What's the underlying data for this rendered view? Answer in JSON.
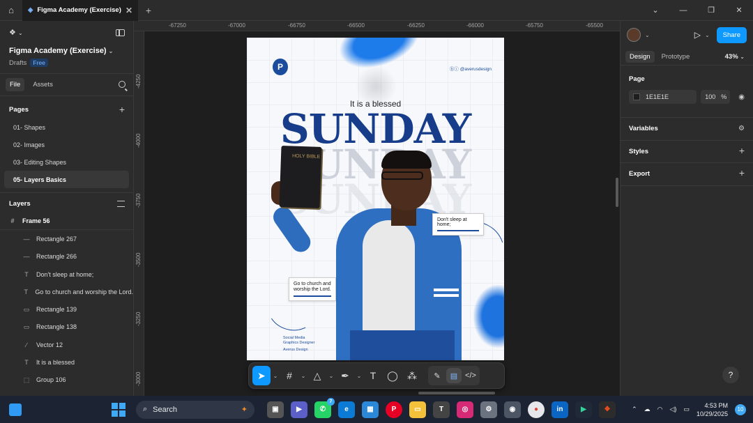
{
  "titlebar": {
    "tab_title": "Figma Academy (Exercise)"
  },
  "left_panel": {
    "file_name": "Figma Academy (Exercise)",
    "location": "Drafts",
    "plan_badge": "Free",
    "tabs": [
      "File",
      "Assets"
    ],
    "pages_header": "Pages",
    "pages": [
      "01- Shapes",
      "02- Images",
      "03- Editing Shapes",
      "05- Layers Basics"
    ],
    "layers_header": "Layers",
    "frame_name": "Frame 56",
    "layers": [
      {
        "icon": "line-icon",
        "glyph": "—",
        "name": "Rectangle 267"
      },
      {
        "icon": "line-icon",
        "glyph": "—",
        "name": "Rectangle 266"
      },
      {
        "icon": "text-icon",
        "glyph": "T",
        "name": "Don't sleep at home;"
      },
      {
        "icon": "text-icon",
        "glyph": "T",
        "name": "Go to church and worship the Lord."
      },
      {
        "icon": "rectangle-icon",
        "glyph": "▭",
        "name": "Rectangle 139"
      },
      {
        "icon": "rectangle-icon",
        "glyph": "▭",
        "name": "Rectangle 138"
      },
      {
        "icon": "vector-icon",
        "glyph": "∕",
        "name": "Vector 12"
      },
      {
        "icon": "text-icon",
        "glyph": "T",
        "name": "It is a blessed"
      },
      {
        "icon": "group-icon",
        "glyph": "⬚",
        "name": "Group 106"
      }
    ]
  },
  "rulers": {
    "top": [
      "-67250",
      "-67000",
      "-66750",
      "-66500",
      "-66250",
      "-66000",
      "-65750",
      "-65500"
    ],
    "left": [
      "-4250",
      "-4000",
      "-3750",
      "-3500",
      "-3250",
      "-3000"
    ]
  },
  "poster": {
    "social": "ⓑⓘ @averusdesign",
    "blessed": "It is a blessed",
    "sunday": "SUNDAY",
    "bible_text": "HOLY BIBLE",
    "callout_home": "Don't sleep at home;",
    "callout_church": "Go to church and worship the Lord.",
    "credit_role": "Social Media Graphics Designer",
    "credit_name": "Averus Design",
    "logo_letter": "P"
  },
  "toolbar": {
    "tools": [
      "move-tool",
      "frame-tool",
      "shape-tool",
      "pen-tool",
      "text-tool",
      "comment-tool",
      "actions-tool"
    ]
  },
  "right_panel": {
    "share_label": "Share",
    "tabs": [
      "Design",
      "Prototype"
    ],
    "zoom": "43%",
    "page_header": "Page",
    "page_color": "1E1E1E",
    "page_opacity": "100",
    "page_opacity_unit": "%",
    "variables_label": "Variables",
    "styles_label": "Styles",
    "export_label": "Export",
    "help_label": "?"
  },
  "taskbar": {
    "search_label": "Search",
    "time": "4:53 PM",
    "date": "10/29/2025",
    "notifications": "10",
    "whatsapp_badge": "7"
  },
  "colors": {
    "accent": "#0d99ff",
    "poster_blue": "#173d8a",
    "panel_bg": "#2c2c2c",
    "canvas_bg": "#1e1e1e"
  }
}
